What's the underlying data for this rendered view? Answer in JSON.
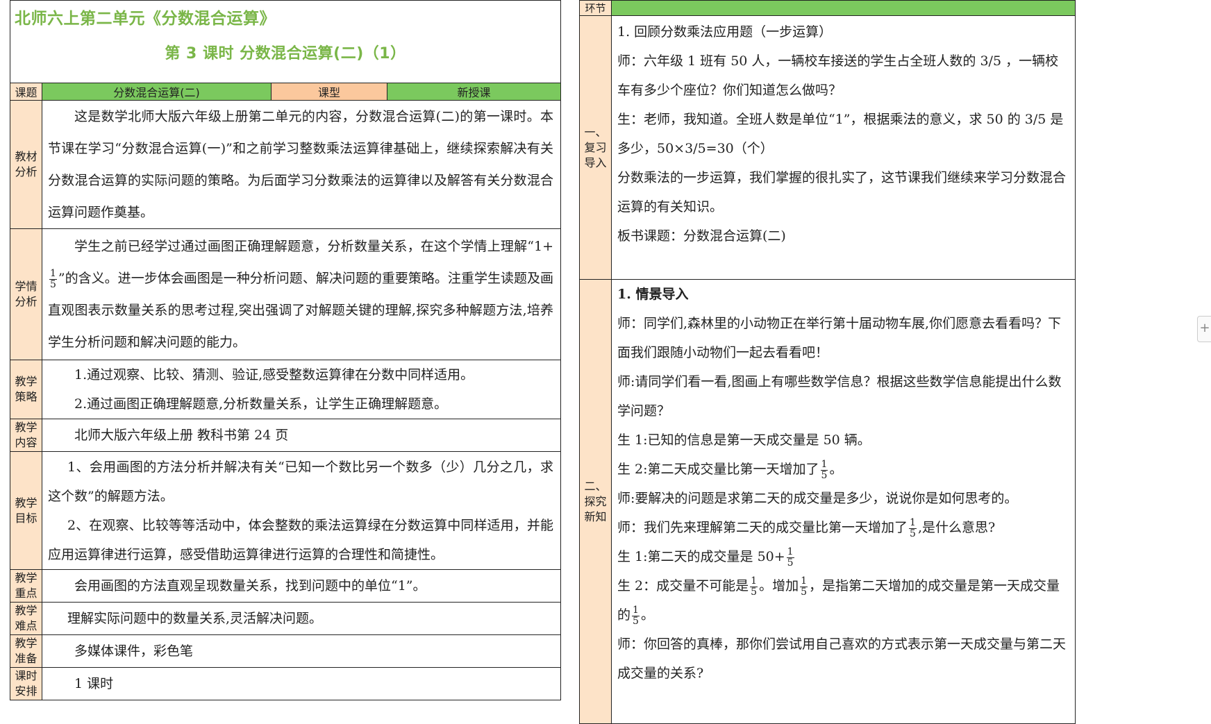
{
  "lesson": {
    "title_main": "北师六上第二单元《分数混合运算》",
    "title_sub": "第 3 课时  分数混合运算(二)（1）",
    "header": {
      "topic_label": "课题",
      "topic_value": "分数混合运算(二)",
      "type_label": "课型",
      "type_value": "新授课"
    },
    "rows": {
      "material": {
        "label": "教材分析",
        "text": "这是数学北师大版六年级上册第二单元的内容，分数混合运算(二)的第一课时。本节课在学习“分数混合运算(一)”和之前学习整数乘法运算律基础上，继续探索解决有关分数混合运算的实际问题的策略。为后面学习分数乘法的运算律以及解答有关分数混合运算问题作奠基。"
      },
      "student": {
        "label": "学情分析",
        "text_a": "学生之前已经学过通过画图正确理解题意，分析数量关系，在这个学情上理解“1+",
        "frac_num": "1",
        "frac_den": "5",
        "text_b": "”的含义。进一步体会画图是一种分析问题、解决问题的重要策略。注重学生读题及画直观图表示数量关系的思考过程,突出强调了对解题关键的理解,探究多种解题方法,培养学生分析问题和解决问题的能力。"
      },
      "strategy": {
        "label": "教学策略",
        "item1": "1.通过观察、比较、猜测、验证,感受整数运算律在分数中同样适用。",
        "item2": "2.通过画图正确理解题意,分析数量关系，让学生正确理解题意。"
      },
      "content": {
        "label": "教学内容",
        "text": "北师大版六年级上册  教科书第 24 页"
      },
      "goals": {
        "label": "教学目标",
        "item1": "1、会用画图的方法分析并解决有关“已知一个数比另一个数多（少）几分之几，求这个数”的解题方法。",
        "item2": "2、在观察、比较等等活动中，体会整数的乘法运算绿在分数运算中同样适用，并能应用运算律进行运算，感受借助运算律进行运算的合理性和简捷性。"
      },
      "key": {
        "label": "教学重点",
        "text": "会用画图的方法直观呈现数量关系，找到问题中的单位“1”。"
      },
      "difficulty": {
        "label": "教学难点",
        "text": "理解实际问题中的数量关系,灵活解决问题。"
      },
      "prep": {
        "label": "教学准备",
        "text": "多媒体课件，彩色笔"
      },
      "time": {
        "label": "课时安排",
        "text": "1 课时"
      }
    }
  },
  "process": {
    "header_label": "环节",
    "stage1": {
      "label": "一、复习导入",
      "p1": "1. 回顾分数乘法应用题（一步运算）",
      "p2": "师：六年级 1 班有 50 人，一辆校车接送的学生占全班人数的 3/5  ，一辆校车有多少个座位？你们知道怎么做吗？",
      "p3": "生：老师，我知道。全班人数是单位“1”，根据乘法的意义，求 50 的 3/5 是多少，50×3/5=30（个）",
      "p4": "分数乘法的一步运算，我们掌握的很扎实了，这节课我们继续来学习分数混合运算的有关知识。",
      "p5": "板书课题：分数混合运算(二)"
    },
    "stage2": {
      "label": "二、探究新知",
      "heading": "1. 情景导入",
      "p1": "师：同学们,森林里的小动物正在举行第十届动物车展,你们愿意去看看吗？下面我们跟随小动物们一起去看看吧！",
      "p2": "师:请同学们看一看,图画上有哪些数学信息？根据这些数学信息能提出什么数学问题？",
      "p3": "生 1:已知的信息是第一天成交量是 50 辆。",
      "p4a": "生 2:第二天成交量比第一天增加了",
      "p4b": "。",
      "p5": "师:要解决的问题是求第二天的成交量是多少，说说你是如何思考的。",
      "p6a": "师：我们先来理解第二天的成交量比第一天增加了",
      "p6b": ",是什么意思?",
      "p7": "生 1:第二天的成交量是 50+",
      "p8a": "生 2：成交量不可能是",
      "p8b": "。增加",
      "p8c": "，是指第二天增加的成交量是第一天成交量的",
      "p8d": "。",
      "p9": "师：你回答的真棒，那你们尝试用自己喜欢的方式表示第一天成交量与第二天成交量的关系?",
      "frac_num": "1",
      "frac_den": "5"
    }
  },
  "ui": {
    "side_button": "+"
  }
}
